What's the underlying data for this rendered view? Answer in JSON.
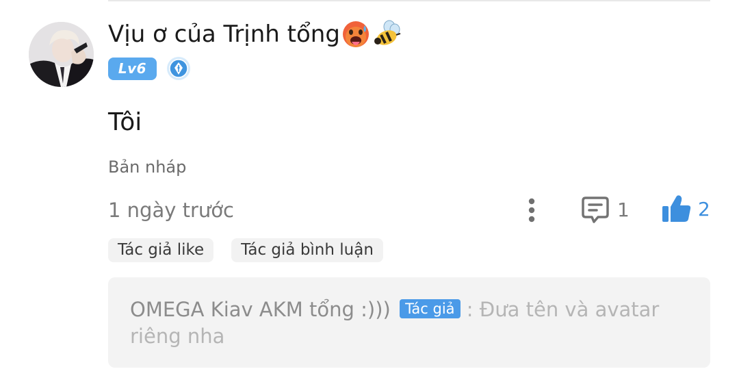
{
  "user": {
    "name": "Vịu ơ của Trịnh tổng",
    "level": "Lv6",
    "emojis": [
      "hot-face-emoji-icon",
      "bee-emoji-icon"
    ],
    "medal": "quill-medal-icon"
  },
  "post": {
    "content": "Tôi",
    "draft_label": "Bản nháp",
    "time": "1 ngày trước"
  },
  "actions": {
    "more": "more-vertical-icon",
    "comment_count": "1",
    "like_count": "2"
  },
  "tags": [
    "Tác giả like",
    "Tác giả bình luận"
  ],
  "reply": {
    "author": "OMEGA Kiav AKM tổng :)))",
    "badge": "Tác giả",
    "separator": " : ",
    "text": "Đưa tên và avatar riêng nha"
  },
  "colors": {
    "accent": "#5aa9ee",
    "like": "#3d8fde",
    "badge_author": "#4a9ae8",
    "muted_text": "#7a7a7a",
    "reply_bg": "#f3f3f3"
  }
}
